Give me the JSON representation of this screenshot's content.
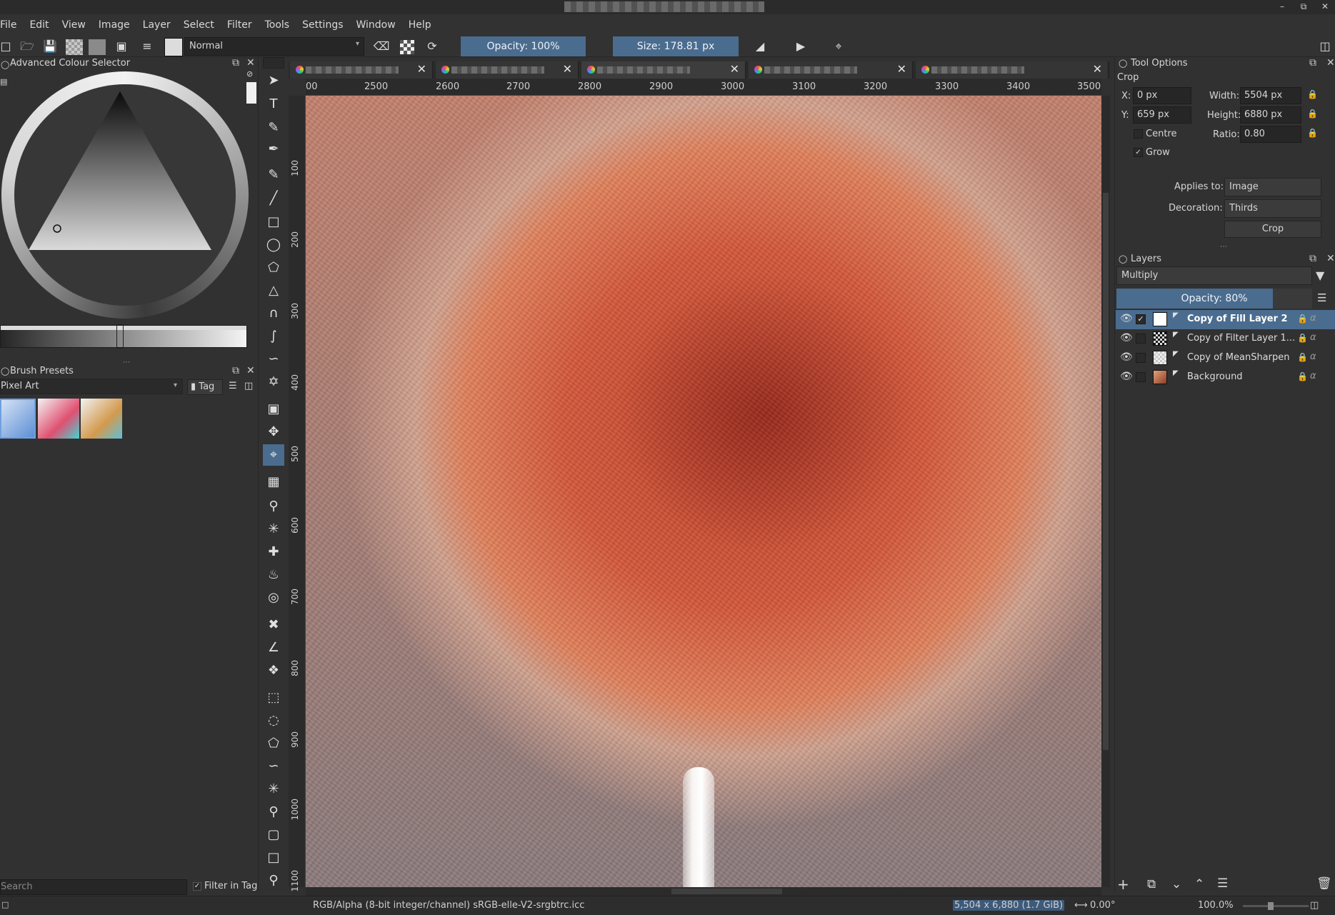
{
  "menu": [
    "File",
    "Edit",
    "View",
    "Image",
    "Layer",
    "Select",
    "Filter",
    "Tools",
    "Settings",
    "Window",
    "Help"
  ],
  "toolbar": {
    "blend_mode": "Normal",
    "opacity": "Opacity: 100%",
    "size": "Size: 178.81 px"
  },
  "left_dock": {
    "colour_selector_title": "Advanced Colour Selector",
    "brush_presets_title": "Brush Presets",
    "preset_tag": "Pixel Art",
    "tag_button": "Tag",
    "search_placeholder": "Search",
    "filter_in_tag": "Filter in Tag"
  },
  "rulers": {
    "h": [
      "00",
      "2500",
      "2600",
      "2700",
      "2800",
      "2900",
      "3000",
      "3100",
      "3200",
      "3300",
      "3400",
      "3500"
    ],
    "v": [
      "100",
      "200",
      "300",
      "400",
      "500",
      "600",
      "700",
      "800",
      "900",
      "1000",
      "1100"
    ]
  },
  "tool_options": {
    "title": "Tool Options",
    "subtitle": "Crop",
    "x_label": "X:",
    "x_value": "0 px",
    "y_label": "Y:",
    "y_value": "659 px",
    "width_label": "Width:",
    "width_value": "5504 px",
    "height_label": "Height:",
    "height_value": "6880 px",
    "ratio_label": "Ratio:",
    "ratio_value": "0.80",
    "centre_label": "Centre",
    "grow_label": "Grow",
    "applies_label": "Applies to:",
    "applies_value": "Image",
    "decoration_label": "Decoration:",
    "decoration_value": "Thirds",
    "crop_button": "Crop"
  },
  "layers_panel": {
    "title": "Layers",
    "blend": "Multiply",
    "opacity": "Opacity:  80%",
    "layers": [
      {
        "name": "Copy of Fill Layer 2"
      },
      {
        "name": "Copy of Filter Layer 1..."
      },
      {
        "name": "Copy of MeanSharpen"
      },
      {
        "name": "Background"
      }
    ]
  },
  "status": {
    "color_profile": "RGB/Alpha (8-bit integer/channel)  sRGB-elle-V2-srgbtrc.icc",
    "dims": "5,504 x 6,880 (1.7 GiB)",
    "rotation": "0.00°",
    "zoom": "100.0%"
  }
}
